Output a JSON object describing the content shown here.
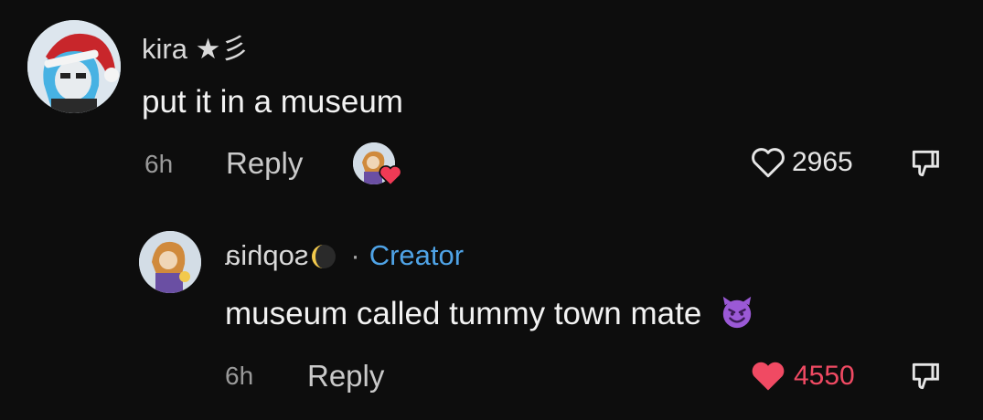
{
  "comments": [
    {
      "username": "kira",
      "username_suffix": " ★彡",
      "text": "put it in a museum",
      "time": "6h",
      "reply_label": "Reply",
      "like_count": "2965",
      "liked": false,
      "creator_liked": true
    },
    {
      "username": "sophia",
      "badge": "Creator",
      "separator": "·",
      "text": "museum called tummy town mate",
      "emoji": "smiling-devil",
      "time": "6h",
      "reply_label": "Reply",
      "like_count": "4550",
      "liked": true
    }
  ],
  "colors": {
    "background": "#0d0d0d",
    "creator_badge": "#4fa3e6",
    "liked_heart": "#f04a63"
  }
}
